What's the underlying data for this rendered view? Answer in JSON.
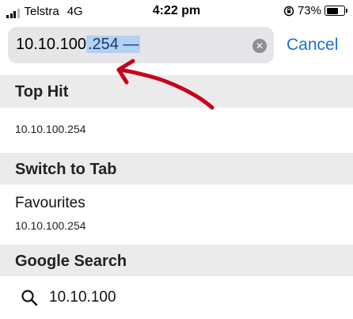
{
  "status": {
    "carrier": "Telstra",
    "network": "4G",
    "time": "4:22 pm",
    "battery": "73%",
    "battery_level": 0.73
  },
  "search": {
    "url_plain": "10.10.100",
    "url_selected": ".254 —",
    "cancel_label": "Cancel"
  },
  "sections": {
    "top_hit": {
      "title": "Top Hit",
      "url": "10.10.100.254"
    },
    "switch_to_tab": {
      "title": "Switch to Tab",
      "tab_title": "Favourites",
      "tab_url": "10.10.100.254"
    },
    "google_search": {
      "title": "Google Search",
      "query": "10.10.100"
    }
  },
  "colors": {
    "accent": "#1e6fd9",
    "annotation_arrow": "#c8001a",
    "selection": "#b3d1f2"
  }
}
